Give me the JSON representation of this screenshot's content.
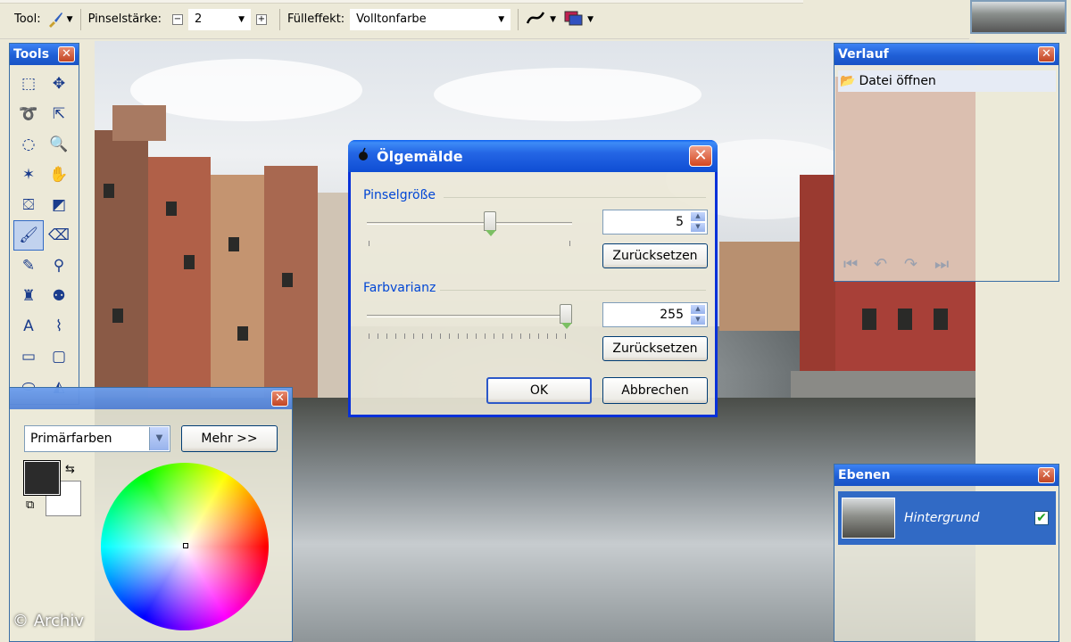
{
  "toolbar": {
    "tool_label": "Tool:",
    "brush_size_label": "Pinselstärke:",
    "brush_size_value": "2",
    "fill_label": "Fülleffekt:",
    "fill_value": "Volltonfarbe"
  },
  "tools_panel": {
    "title": "Tools",
    "tools": [
      {
        "name": "rectangle-select-icon",
        "glyph": "⬚"
      },
      {
        "name": "move-selection-icon",
        "glyph": "✥"
      },
      {
        "name": "lasso-select-icon",
        "glyph": "➰"
      },
      {
        "name": "move-selected-icon",
        "glyph": "⇱"
      },
      {
        "name": "ellipse-select-icon",
        "glyph": "◌"
      },
      {
        "name": "zoom-icon",
        "glyph": "🔍"
      },
      {
        "name": "magic-wand-icon",
        "glyph": "✶"
      },
      {
        "name": "pan-icon",
        "glyph": "✋"
      },
      {
        "name": "paint-bucket-icon",
        "glyph": "⛋"
      },
      {
        "name": "gradient-icon",
        "glyph": "◩"
      },
      {
        "name": "paintbrush-icon",
        "glyph": "🖌"
      },
      {
        "name": "eraser-icon",
        "glyph": "⌫"
      },
      {
        "name": "pencil-icon",
        "glyph": "✎"
      },
      {
        "name": "color-picker-icon",
        "glyph": "⚲"
      },
      {
        "name": "clone-stamp-icon",
        "glyph": "♜"
      },
      {
        "name": "recolor-icon",
        "glyph": "⚉"
      },
      {
        "name": "text-icon",
        "glyph": "A"
      },
      {
        "name": "line-curve-icon",
        "glyph": "⌇"
      },
      {
        "name": "rectangle-icon",
        "glyph": "▭"
      },
      {
        "name": "rounded-rectangle-icon",
        "glyph": "▢"
      },
      {
        "name": "ellipse-icon",
        "glyph": "⬭"
      },
      {
        "name": "freeform-shape-icon",
        "glyph": "◭"
      }
    ]
  },
  "colors_panel": {
    "palette_value": "Primärfarben",
    "more_button": "Mehr >>",
    "primary_color": "#2b2b2b",
    "secondary_color": "#ffffff"
  },
  "history_panel": {
    "title": "Verlauf",
    "items": [
      "Datei öffnen"
    ]
  },
  "layers_panel": {
    "title": "Ebenen",
    "layers": [
      {
        "name": "Hintergrund",
        "visible": true
      }
    ]
  },
  "dialog": {
    "title": "Ölgemälde",
    "brush_group": "Pinselgröße",
    "brush_value": "5",
    "brush_level": 0.6,
    "variance_group": "Farbvarianz",
    "variance_value": "255",
    "variance_level": 1.0,
    "reset_label": "Zurücksetzen",
    "ok_label": "OK",
    "cancel_label": "Abbrechen"
  },
  "watermark": "© Archiv"
}
